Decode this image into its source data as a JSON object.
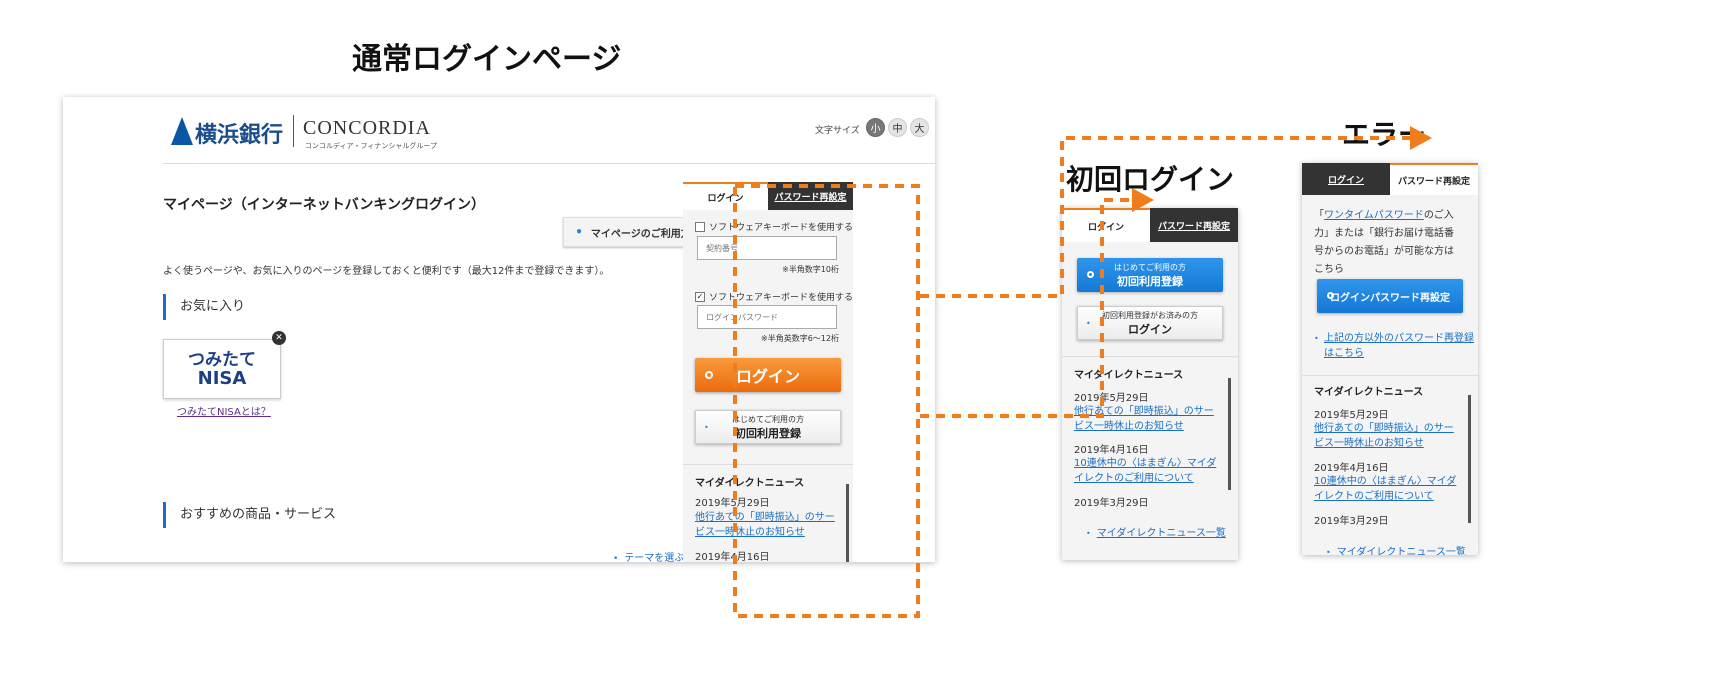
{
  "headings": {
    "normal": "通常ログインページ",
    "first": "初回ログイン",
    "error": "エラー"
  },
  "header": {
    "bank_name": "横浜銀行",
    "group_name": "CONCORDIA",
    "group_sub": "コンコルディア・フィナンシャルグループ",
    "font_size_label": "文字サイズ",
    "font_sizes": [
      "小",
      "中",
      "大"
    ]
  },
  "main": {
    "page_title": "マイページ（インターネットバンキングログイン）",
    "howto_button": "マイページのご利用方法",
    "intro": "よく使うページや、お気に入りのページを登録しておくと便利です（最大12件まで登録できます）。",
    "favorites_title": "お気に入り",
    "nisa_line1": "つみたて",
    "nisa_line2": "NISA",
    "nisa_link": "つみたてNISAとは？",
    "recommend_title": "おすすめの商品・サービス",
    "theme_link": "テーマを選ぶ"
  },
  "login_widget": {
    "tab_login": "ログイン",
    "tab_reset": "パスワード再設定",
    "soft_keyboard": "ソフトウェアキーボードを使用する",
    "contract_placeholder": "契約番号",
    "contract_note": "※半角数字10桁",
    "password_placeholder": "ログインパスワード",
    "password_note": "※半角英数字6～12桁",
    "login_button": "ログイン",
    "first_line1": "はじめてご利用の方",
    "first_line2": "初回利用登録",
    "news_title": "マイダイレクトニュース",
    "news": [
      {
        "date": "2019年5月29日",
        "title": "他行あての「即時振込」のサービス一時休止のお知らせ"
      },
      {
        "date": "2019年4月16日",
        "title": "10連休中の〈はまぎん〉マイダイレクトのご利用について"
      },
      {
        "date": "2019年3月29日",
        "title": ""
      }
    ],
    "news_more": "マイダイレクトニュース一覧"
  },
  "first_panel": {
    "registered_line1": "初回利用登録がお済みの方",
    "registered_line2": "ログイン"
  },
  "error_panel": {
    "text_prefix": "「",
    "text_link": "ワンタイムパスワード",
    "text_rest": "のご入力」または「銀行お届け電話番号からのお電話」が可能な方はこちら",
    "reset_button": "ログインパスワード再設定",
    "other_link": "上記の方以外のパスワード再登録はこちら"
  },
  "colors": {
    "accent_orange": "#f07d1c",
    "link_blue": "#1a6fc4",
    "brand_navy": "#1e3f86"
  }
}
